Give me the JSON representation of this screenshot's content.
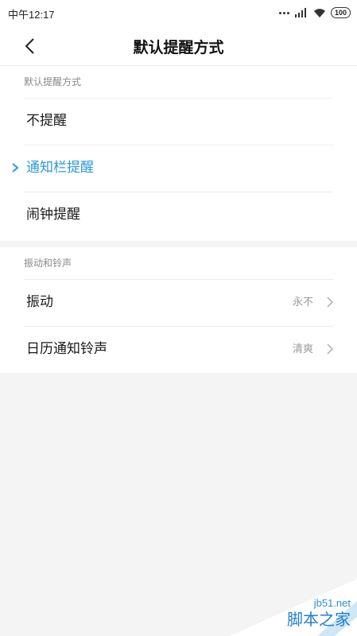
{
  "status_bar": {
    "time": "中午12:17",
    "battery": "100"
  },
  "header": {
    "title": "默认提醒方式",
    "back_icon": "chevron-left-icon"
  },
  "section_reminder": {
    "title": "默认提醒方式",
    "options": [
      {
        "label": "不提醒",
        "selected": false
      },
      {
        "label": "通知栏提醒",
        "selected": true
      },
      {
        "label": "闹钟提醒",
        "selected": false
      }
    ]
  },
  "section_sound": {
    "title": "振动和铃声",
    "rows": [
      {
        "label": "振动",
        "value": "永不"
      },
      {
        "label": "日历通知铃声",
        "value": "清爽"
      }
    ]
  },
  "colors": {
    "accent": "#2b9ad8",
    "background": "#f4f4f4",
    "card": "#ffffff"
  },
  "watermark": {
    "url": "jb51.net",
    "name": "脚本之家"
  }
}
